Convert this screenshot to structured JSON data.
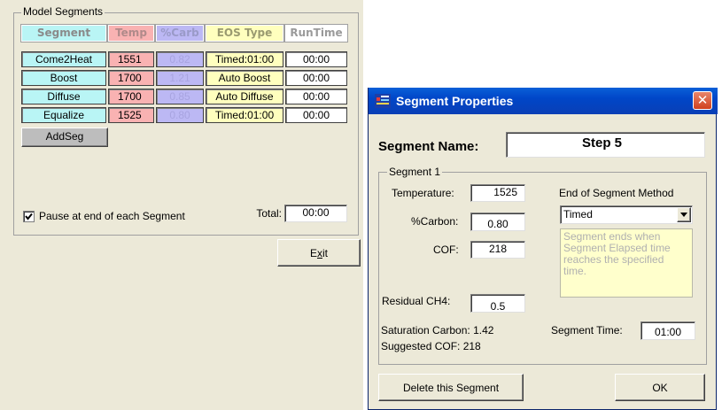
{
  "colors": {
    "segment": "#b9f5f5",
    "temp": "#f9b2b2",
    "carb": "#bcb8f4",
    "eos": "#ffffbe",
    "runtime": "#ffffff",
    "addseg": "#bdbdbd",
    "note_bg": "#ffffcc",
    "note_text": "#b0b0b0"
  },
  "model_segments": {
    "group_label": "Model Segments",
    "headers": {
      "segment": "Segment",
      "temp": "Temp",
      "carb": "%Carb",
      "eos": "EOS Type",
      "runtime": "RunTime"
    },
    "rows": [
      {
        "segment": "Come2Heat",
        "temp": "1551",
        "carb": "0.82",
        "eos": "Timed:01:00",
        "runtime": "00:00"
      },
      {
        "segment": "Boost",
        "temp": "1700",
        "carb": "1.21",
        "eos": "Auto Boost",
        "runtime": "00:00"
      },
      {
        "segment": "Diffuse",
        "temp": "1700",
        "carb": "0.85",
        "eos": "Auto Diffuse",
        "runtime": "00:00"
      },
      {
        "segment": "Equalize",
        "temp": "1525",
        "carb": "0.80",
        "eos": "Timed:01:00",
        "runtime": "00:00"
      }
    ],
    "addseg_label": "AddSeg",
    "pause_label": "Pause at end of each Segment",
    "pause_checked": true,
    "total_label": "Total:",
    "total_value": "00:00"
  },
  "exit_label": "Exit",
  "dialog": {
    "title": "Segment Properties",
    "close_glyph": "✕",
    "name_label": "Segment Name:",
    "name_value": "Step 5",
    "group_label": "Segment 1",
    "temperature_label": "Temperature:",
    "temperature_value": "1525",
    "carbon_label": "%Carbon:",
    "carbon_value": "0.80",
    "cof_label": "COF:",
    "cof_value": "218",
    "residual_label": "Residual CH4:",
    "residual_value": "0.5",
    "eos_method_label": "End of Segment Method",
    "eos_method_value": "Timed",
    "eos_description": "Segment ends when Segment Elapsed time reaches the specified time.",
    "saturation_text": "Saturation Carbon: 1.42",
    "suggested_text": "Suggested COF: 218",
    "segment_time_label": "Segment Time:",
    "segment_time_value": "01:00",
    "delete_label": "Delete this Segment",
    "ok_label": "OK"
  }
}
